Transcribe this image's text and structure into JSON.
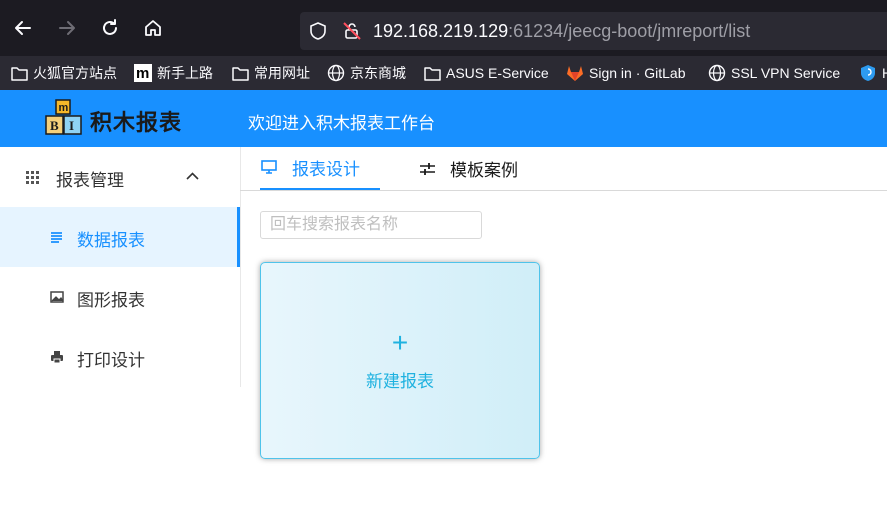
{
  "browser": {
    "url_host": "192.168.219.129",
    "url_rest": ":61234/jeecg-boot/jmreport/list",
    "bookmarks": [
      {
        "icon": "folder-icon",
        "label": "火狐官方站点"
      },
      {
        "icon": "m-logo-icon",
        "label": "新手上路"
      },
      {
        "icon": "folder-icon",
        "label": "常用网址"
      },
      {
        "icon": "globe-icon",
        "label": "京东商城"
      },
      {
        "icon": "folder-icon",
        "label": "ASUS E-Service"
      },
      {
        "icon": "gitlab-icon",
        "label": "Sign in · GitLab"
      },
      {
        "icon": "globe-icon",
        "label": "SSL VPN Service"
      },
      {
        "icon": "shield-icon",
        "label": "H"
      }
    ]
  },
  "app": {
    "logo_text": "积木报表",
    "logo_letters": [
      "m",
      "B",
      "I"
    ],
    "welcome": "欢迎进入积木报表工作台"
  },
  "sidebar": {
    "group_label": "报表管理",
    "items": [
      {
        "label": "数据报表",
        "icon": "list-icon",
        "active": true
      },
      {
        "label": "图形报表",
        "icon": "image-icon",
        "active": false
      },
      {
        "label": "打印设计",
        "icon": "printer-icon",
        "active": false
      }
    ]
  },
  "tabs": [
    {
      "label": "报表设计",
      "icon": "monitor-icon",
      "active": true
    },
    {
      "label": "模板案例",
      "icon": "sliders-icon",
      "active": false
    }
  ],
  "search": {
    "placeholder": "回车搜索报表名称"
  },
  "new_card": {
    "plus": "+",
    "label": "新建报表"
  },
  "colors": {
    "brand": "#1890ff",
    "card_accent": "#1fb2e0"
  }
}
